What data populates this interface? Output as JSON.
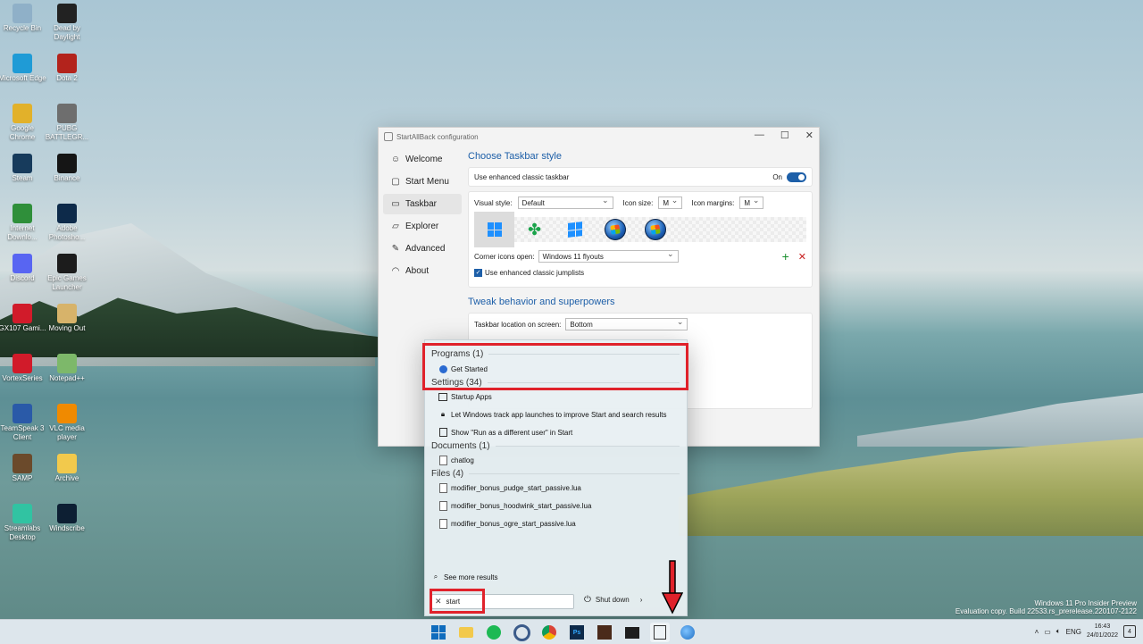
{
  "desktop": {
    "icons": [
      {
        "label": "Recycle Bin",
        "icon": "recycle-bin-icon",
        "color": "#8fb0c8"
      },
      {
        "label": "Dead by Daylight",
        "icon": "dead-by-daylight-icon",
        "color": "#222222"
      },
      {
        "label": "Microsoft Edge",
        "icon": "edge-icon",
        "color": "#1f9bd6"
      },
      {
        "label": "Dota 2",
        "icon": "dota2-icon",
        "color": "#b3231c"
      },
      {
        "label": "Google Chrome",
        "icon": "chrome-icon",
        "color": "#e2b12a"
      },
      {
        "label": "PUBG BATTLEGR...",
        "icon": "pubg-icon",
        "color": "#6e6e6e"
      },
      {
        "label": "Steam",
        "icon": "steam-icon",
        "color": "#173b5c"
      },
      {
        "label": "Binance",
        "icon": "binance-icon",
        "color": "#151515"
      },
      {
        "label": "Internet Downlo...",
        "icon": "idm-icon",
        "color": "#2f8f3a"
      },
      {
        "label": "Adobe Photosho...",
        "icon": "photoshop-icon",
        "color": "#0d2a4a"
      },
      {
        "label": "Discord",
        "icon": "discord-icon",
        "color": "#5865f2"
      },
      {
        "label": "Epic Games Launcher",
        "icon": "epic-icon",
        "color": "#1c1c1c"
      },
      {
        "label": "GX107 Gami...",
        "icon": "gx107-icon",
        "color": "#d11b2a"
      },
      {
        "label": "Moving Out",
        "icon": "moving-out-icon",
        "color": "#d7b36a"
      },
      {
        "label": "VortexSeries",
        "icon": "vortex-icon",
        "color": "#d11b2a"
      },
      {
        "label": "Notepad++",
        "icon": "notepadpp-icon",
        "color": "#7db86a"
      },
      {
        "label": "TeamSpeak 3 Client",
        "icon": "teamspeak-icon",
        "color": "#2a5aa8"
      },
      {
        "label": "VLC media player",
        "icon": "vlc-icon",
        "color": "#f08a00"
      },
      {
        "label": "SAMP",
        "icon": "samp-icon",
        "color": "#6b4a2b"
      },
      {
        "label": "Archive",
        "icon": "folder-icon",
        "color": "#f2c94c"
      },
      {
        "label": "Streamlabs Desktop",
        "icon": "streamlabs-icon",
        "color": "#31c3a2"
      },
      {
        "label": "Windscribe",
        "icon": "windscribe-icon",
        "color": "#0d1f33"
      }
    ]
  },
  "window": {
    "title": "StartAllBack configuration",
    "controls": {
      "minimize": "—",
      "maximize": "☐",
      "close": "✕"
    },
    "nav": [
      {
        "label": "Welcome",
        "icon": "smile-icon",
        "glyph": "☺"
      },
      {
        "label": "Start Menu",
        "icon": "start-menu-icon",
        "glyph": "▢"
      },
      {
        "label": "Taskbar",
        "icon": "taskbar-icon",
        "glyph": "▭"
      },
      {
        "label": "Explorer",
        "icon": "folder-icon",
        "glyph": "▱"
      },
      {
        "label": "Advanced",
        "icon": "wrench-icon",
        "glyph": "✎"
      },
      {
        "label": "About",
        "icon": "speedometer-icon",
        "glyph": "◠"
      }
    ],
    "taskbar_style": {
      "heading": "Choose Taskbar style",
      "enhanced_label": "Use enhanced classic taskbar",
      "enhanced_state": "On",
      "visual_style_label": "Visual style:",
      "visual_style_value": "Default",
      "icon_size_label": "Icon size:",
      "icon_size_value": "M",
      "icon_margins_label": "Icon margins:",
      "icon_margins_value": "M",
      "corner_icons_label": "Corner icons open:",
      "corner_icons_value": "Windows 11 flyouts",
      "jumplists_label": "Use enhanced classic jumplists",
      "add_glyph": "+",
      "remove_glyph": "✕"
    },
    "tweak": {
      "heading": "Tweak behavior and superpowers",
      "location_label": "Taskbar location on screen:",
      "location_value": "Bottom"
    }
  },
  "start_menu": {
    "programs_header": "Programs (1)",
    "program_items": [
      {
        "label": "Get Started",
        "icon": "get-started-icon"
      }
    ],
    "settings_header": "Settings (34)",
    "settings_items": [
      {
        "label": "Startup Apps",
        "icon": "startup-apps-icon"
      },
      {
        "label": "Let Windows track app launches to improve Start and search results",
        "icon": "lock-icon"
      },
      {
        "label": "Show \"Run as a different user\" in Start",
        "icon": "run-as-icon"
      }
    ],
    "documents_header": "Documents (1)",
    "document_items": [
      {
        "label": "chatlog"
      }
    ],
    "files_header": "Files (4)",
    "file_items": [
      {
        "label": "modifier_bonus_pudge_start_passive.lua"
      },
      {
        "label": "modifier_bonus_hoodwink_start_passive.lua"
      },
      {
        "label": "modifier_bonus_ogre_start_passive.lua"
      }
    ],
    "see_more": "See more results",
    "search_value": "start",
    "shutdown_label": "Shut down"
  },
  "taskbar": {
    "lang": "ENG",
    "time": "16:43",
    "date": "24/01/2022",
    "notifications": "4"
  },
  "watermark": {
    "line1": "Windows 11 Pro Insider Preview",
    "line2": "Evaluation copy. Build 22533.rs_prerelease.220107-2122"
  },
  "colors": {
    "accent": "#1d5fa8",
    "highlight_red": "#e0222b"
  }
}
